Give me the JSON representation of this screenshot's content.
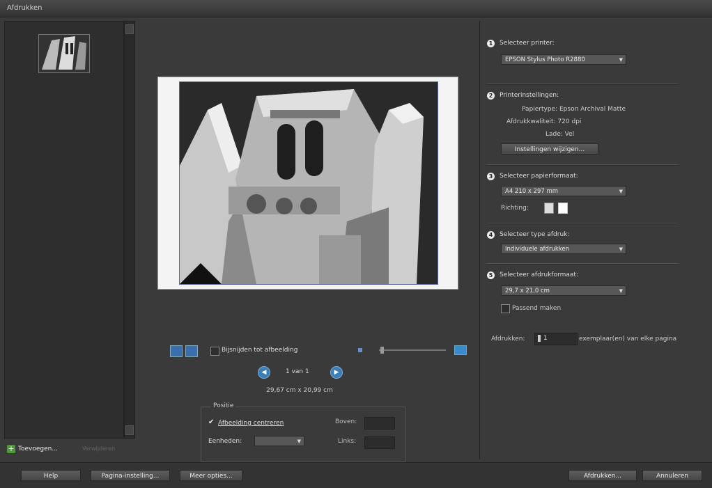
{
  "window": {
    "title": "Afdrukken"
  },
  "left": {
    "add_label": "Toevoegen...",
    "remove_label": "Verwijderen"
  },
  "center": {
    "crop_to_fit_label": "Bijsnijden tot afbeelding",
    "page_indicator": "1 van 1",
    "dimensions": "29,67 cm x 20,99 cm",
    "position": {
      "legend": "Positie",
      "center_label": "Afbeelding centreren",
      "units_label": "Eenheden:",
      "top_label": "Boven:",
      "left_label": "Links:"
    }
  },
  "right": {
    "s1": {
      "num": "1",
      "title": "Selecteer printer:",
      "value": "EPSON Stylus Photo R2880"
    },
    "s2": {
      "num": "2",
      "title": "Printerinstellingen:",
      "paper_type": "Papiertype: Epson Archival Matte",
      "resolution": "Afdrukkwaliteit: 720 dpi",
      "tray": "Lade: Vel",
      "change_button": "Instellingen wijzigen..."
    },
    "s3": {
      "num": "3",
      "title": "Selecteer papierformaat:",
      "value": "A4 210 x 297 mm",
      "orientation_label": "Richting:"
    },
    "s4": {
      "num": "4",
      "title": "Selecteer type afdruk:",
      "value": "Individuele afdrukken"
    },
    "s5": {
      "num": "5",
      "title": "Selecteer afdrukformaat:",
      "value": "29,7 x 21,0 cm",
      "fit_label": "Passend maken"
    },
    "copies_label": "Afdrukken:",
    "copies_value": "1",
    "copies_suffix": "exemplaar(en) van elke pagina"
  },
  "bottom": {
    "help": "Help",
    "page_setup": "Pagina-instelling...",
    "more_options": "Meer opties...",
    "print": "Afdrukken...",
    "cancel": "Annuleren"
  },
  "icons": {
    "rotate_left": "rotate-left-icon",
    "rotate_right": "rotate-right-icon",
    "prev": "previous-page-icon",
    "next": "next-page-icon"
  }
}
